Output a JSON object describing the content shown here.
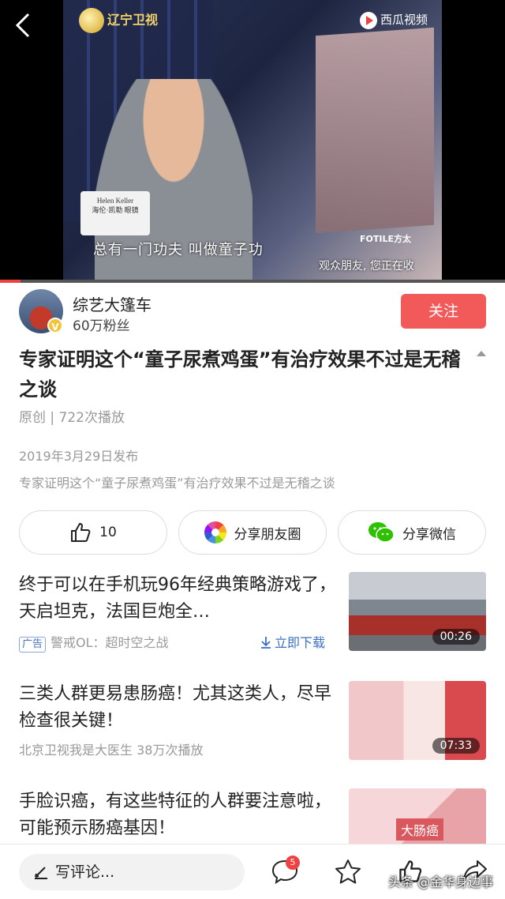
{
  "video": {
    "channel_logo": "辽宁卫视",
    "platform_logo": "西瓜视频",
    "podium_brand_en": "Helen Keller",
    "podium_brand_cn": "海伦·凯勒 眼镜",
    "subtitle": "总有一门功夫  叫做童子功",
    "sponsor": "FOTILE方太",
    "subtitle2": "观众朋友, 您正在收",
    "progress_fraction": 0.04
  },
  "author": {
    "name": "综艺大篷车",
    "fans": "60万粉丝",
    "follow_label": "关注",
    "badge": "V"
  },
  "article": {
    "title": "专家证明这个“童子尿煮鸡蛋”有治疗效果不过是无稽之谈",
    "meta": "原创 | 722次播放",
    "published": "2019年3月29日发布",
    "description": "专家证明这个“童子尿煮鸡蛋”有治疗效果不过是无稽之谈"
  },
  "actions": {
    "like_count": "10",
    "share_moments": "分享朋友圈",
    "share_wechat": "分享微信"
  },
  "feed": [
    {
      "title": "终于可以在手机玩96年经典策略游戏了，天启坦克，法国巨炮全…",
      "ad_tag": "广告",
      "source": "警戒OL：超时空之战",
      "download": "立即下载",
      "duration": "00:26"
    },
    {
      "title": "三类人群更易患肠癌！尤其这类人，尽早检查很关键！",
      "source": "北京卫视我是大医生   38万次播放",
      "duration": "07:33"
    },
    {
      "title": "手脸识癌，有这些特征的人群要注意啦，可能预示肠癌基因！",
      "thumb_label": "大肠癌"
    }
  ],
  "bottom": {
    "comment_placeholder": "写评论...",
    "comment_count": "5",
    "watermark": "头条 @金华身边事"
  },
  "colors": {
    "accent": "#f04142",
    "follow": "#f25a59"
  }
}
